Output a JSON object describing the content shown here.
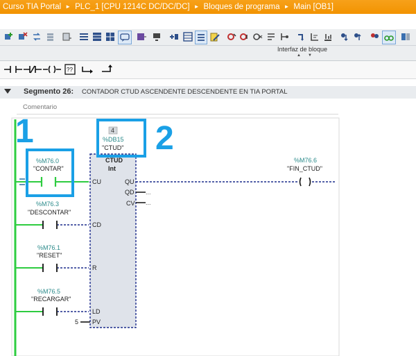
{
  "breadcrumb": {
    "items": [
      "Curso TIA Portal",
      "PLC_1 [CPU 1214C DC/DC/DC]",
      "Bloques de programa",
      "Main [OB1]"
    ],
    "separator": "►"
  },
  "interfaz": {
    "label": "Interfaz de bloque"
  },
  "segment": {
    "title": "Segmento 26:",
    "description": "CONTADOR CTUD ASCENDENTE DESCENDENTE EN TIA PORTAL",
    "comment_label": "Comentario"
  },
  "contacts": {
    "contar": {
      "address": "%M76.0",
      "symbol": "\"CONTAR\""
    },
    "descontar": {
      "address": "%M76.3",
      "symbol": "\"DESCONTAR\""
    },
    "reset": {
      "address": "%M76.1",
      "symbol": "\"RESET\""
    },
    "recargar": {
      "address": "%M76.5",
      "symbol": "\"RECARGAR\""
    }
  },
  "block": {
    "instance_number": "4",
    "db_address": "%DB15",
    "db_symbol": "\"CTUD\"",
    "type": "CTUD",
    "datatype": "Int",
    "pins": {
      "cu": "CU",
      "cd": "CD",
      "r": "R",
      "ld": "LD",
      "pv": "PV",
      "qu": "QU",
      "qd": "QD",
      "cv": "CV"
    },
    "pv_value": "5",
    "dots": "..."
  },
  "coil": {
    "address": "%M76.6",
    "symbol": "\"FIN_CTUD\""
  },
  "annotations": {
    "one": "1",
    "two": "2"
  },
  "colors": {
    "breadcrumb_bg": "#f29300",
    "power_rail": "#2ecc40",
    "wire_dashed": "#1c2c8c",
    "highlight": "#1aa0e6",
    "block_fill": "#dfe3ea"
  }
}
